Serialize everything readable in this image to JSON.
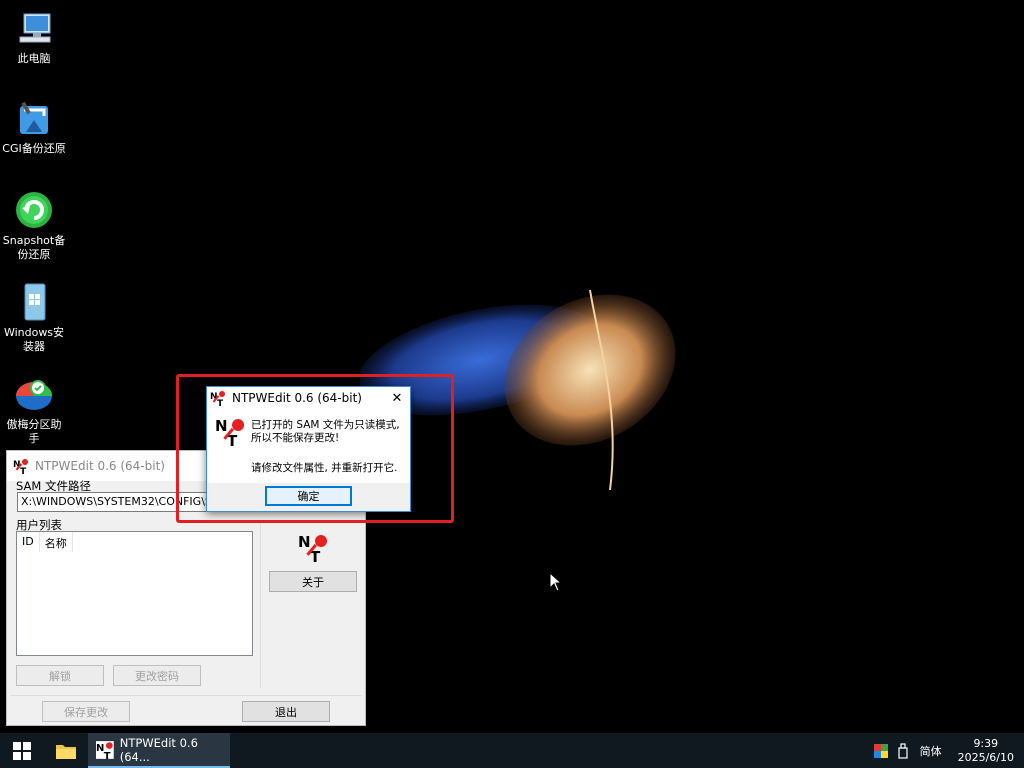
{
  "desktop": {
    "icons": [
      {
        "label": "此电脑",
        "icon": "computer-icon"
      },
      {
        "label": "CGI备份还原",
        "icon": "cgi-backup-icon"
      },
      {
        "label": "Snapshot备份还原",
        "icon": "snapshot-icon"
      },
      {
        "label": "Windows安装器",
        "icon": "windows-installer-icon"
      },
      {
        "label": "傲梅分区助手",
        "icon": "partition-assistant-icon"
      }
    ]
  },
  "main_window": {
    "title": "NTPWEdit 0.6 (64-bit)",
    "sam_path_label": "SAM 文件路径",
    "sam_path_value": "X:\\WINDOWS\\SYSTEM32\\CONFIG\\S",
    "user_list_label": "用户列表",
    "columns": [
      "ID",
      "名称"
    ],
    "about_button": "关于",
    "unlock_button": "解锁",
    "change_password_button": "更改密码",
    "save_button": "保存更改",
    "exit_button": "退出"
  },
  "message_box": {
    "title": "NTPWEdit 0.6 (64-bit)",
    "line1": "已打开的 SAM 文件为只读模式,",
    "line2": "所以不能保存更改!",
    "line3": "请修改文件属性, 并重新打开它.",
    "ok_button": "确定",
    "close_glyph": "✕"
  },
  "taskbar": {
    "task_label": "NTPWEdit 0.6 (64...",
    "ime_label": "简体",
    "time": "9:39",
    "date": "2025/6/10"
  },
  "colors": {
    "highlight": "#e02020",
    "taskbar_bg": "#101820",
    "accent": "#0078d7"
  }
}
